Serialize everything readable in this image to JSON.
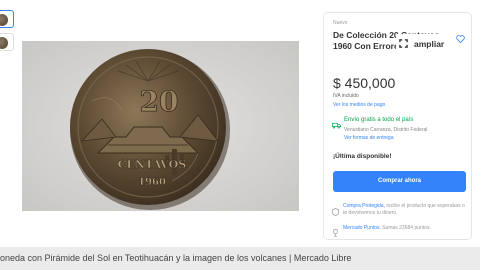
{
  "panel": {
    "condition": "Nuevo",
    "title": "De Colección 20 Centavos 1960 Con Errores.",
    "expand_label": "ampliar",
    "price": "$ 450,000",
    "iva": "IVA incluido",
    "payment_link": "Ver los medios de pago",
    "shipping": "Envío gratis a todo el país",
    "seller_location": "Venustiano Carranza, Distrito Federal",
    "delivery_link": "Ver formas de entrega",
    "last_available": "¡Última disponible!",
    "buy_button": "Comprar ahora",
    "protection_link": "Compra Protegida,",
    "protection_text": " recibe el producto que esperabas o te devolvemos tu dinero.",
    "points_link": "Mercado Puntos.",
    "points_text": " Sumas 23684 puntos."
  },
  "coin": {
    "denomination": "20",
    "word": "CENTAVOS",
    "year": "1960"
  },
  "caption": "oneda con Pirámide del Sol en Teotihuacán y la imagen de los volcanes | Mercado Libre",
  "colors": {
    "accent": "#3483fa",
    "shipping_green": "#00a650",
    "coin_bronze": "#6b5a43"
  },
  "icons": [
    "thumbnail-coin",
    "heart-icon",
    "expand-icon",
    "truck-icon",
    "shield-icon",
    "trophy-icon"
  ]
}
